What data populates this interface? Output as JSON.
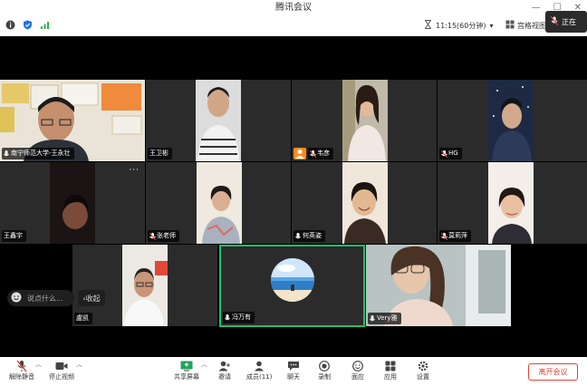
{
  "window": {
    "title": "腾讯会议"
  },
  "infobar": {
    "meeting_time": "11:15(60分钟)",
    "view_label": "宫格视图",
    "recording_label": "正在"
  },
  "participants": [
    {
      "name": "南宁师范大学-王永壮",
      "muted": false
    },
    {
      "name": "王卫彬",
      "muted": false
    },
    {
      "name": "韦彦",
      "muted": true
    },
    {
      "name": "HG",
      "muted": true
    },
    {
      "name": "王鑫宇",
      "muted": false
    },
    {
      "name": "张老师",
      "muted": true
    },
    {
      "name": "何英姿",
      "muted": false
    },
    {
      "name": "莫莉萍",
      "muted": true
    },
    {
      "name": "盧凯",
      "muted": false
    },
    {
      "name": "冯万有",
      "muted": false
    },
    {
      "name": "Very雅",
      "muted": false
    }
  ],
  "chat": {
    "placeholder": "说点什么...",
    "collapse_label": "收起"
  },
  "toolbar": {
    "mute": "解除静音",
    "stop_video": "停止视频",
    "share_screen": "共享屏幕",
    "invite": "邀请",
    "members": "成员(11)",
    "chat": "聊天",
    "record": "录制",
    "interact": "面应",
    "apps": "应用",
    "settings": "设置",
    "leave": "离开会议"
  },
  "colors": {
    "active_speaker": "#1fbf6a",
    "leave": "#e0453a",
    "brand_blue": "#1a73e8"
  }
}
